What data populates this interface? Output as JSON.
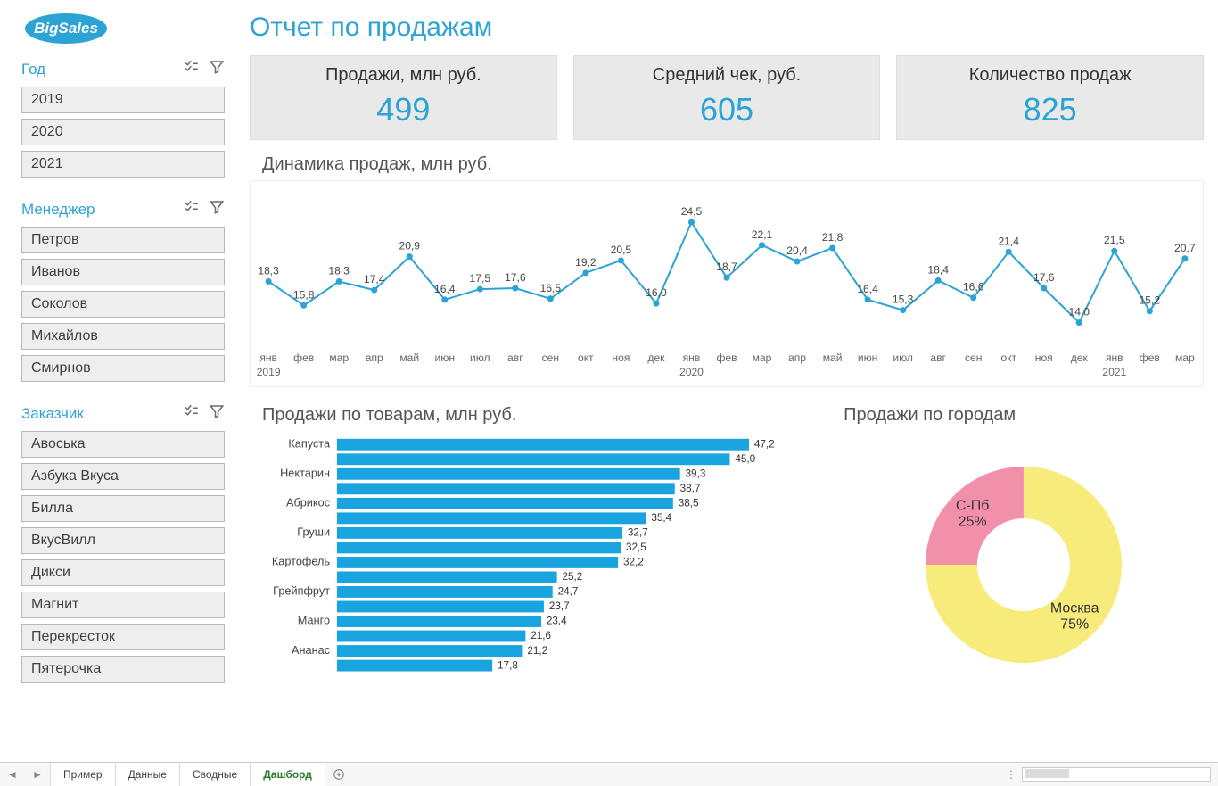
{
  "brand": "BigSales",
  "page_title": "Отчет по продажам",
  "slicers": {
    "year": {
      "title": "Год",
      "items": [
        "2019",
        "2020",
        "2021"
      ]
    },
    "manager": {
      "title": "Менеджер",
      "items": [
        "Петров",
        "Иванов",
        "Соколов",
        "Михайлов",
        "Смирнов"
      ]
    },
    "customer": {
      "title": "Заказчик",
      "items": [
        "Авоська",
        "Азбука Вкуса",
        "Билла",
        "ВкусВилл",
        "Дикси",
        "Магнит",
        "Перекресток",
        "Пятерочка"
      ]
    }
  },
  "cards": [
    {
      "label": "Продажи, млн руб.",
      "value": "499"
    },
    {
      "label": "Средний чек, руб.",
      "value": "605"
    },
    {
      "label": "Количество продаж",
      "value": "825"
    }
  ],
  "tabs": {
    "items": [
      "Пример",
      "Данные",
      "Сводные",
      "Дашборд"
    ],
    "active": "Дашборд"
  },
  "chart_data": [
    {
      "id": "trend",
      "type": "line",
      "title": "Динамика продаж, млн руб.",
      "x": [
        "янв",
        "фев",
        "мар",
        "апр",
        "май",
        "июн",
        "июл",
        "авг",
        "сен",
        "окт",
        "ноя",
        "дек",
        "янв",
        "фев",
        "мар",
        "апр",
        "май",
        "июн",
        "июл",
        "авг",
        "сен",
        "окт",
        "ноя",
        "дек",
        "янв",
        "фев",
        "мар"
      ],
      "year_group_labels": [
        {
          "label": "2019",
          "start_index": 0
        },
        {
          "label": "2020",
          "start_index": 12
        },
        {
          "label": "2021",
          "start_index": 24
        }
      ],
      "values": [
        18.3,
        15.8,
        18.3,
        17.4,
        20.9,
        16.4,
        17.5,
        17.6,
        16.5,
        19.2,
        20.5,
        16.0,
        24.5,
        18.7,
        22.1,
        20.4,
        21.8,
        16.4,
        15.3,
        18.4,
        16.6,
        21.4,
        17.6,
        14.0,
        21.5,
        15.2,
        20.7
      ],
      "ylim": [
        12,
        26
      ]
    },
    {
      "id": "products",
      "type": "bar",
      "orientation": "horizontal",
      "title": "Продажи по товарам, млн руб.",
      "categories": [
        "Капуста",
        "",
        "Нектарин",
        "",
        "Абрикос",
        "",
        "Груши",
        "",
        "Картофель",
        "",
        "Грейпфрут",
        "",
        "Манго",
        "",
        "Ананас",
        ""
      ],
      "values": [
        47.2,
        45.0,
        39.3,
        38.7,
        38.5,
        35.4,
        32.7,
        32.5,
        32.2,
        25.2,
        24.7,
        23.7,
        23.4,
        21.6,
        21.2,
        17.8
      ],
      "xlim": [
        0,
        50
      ]
    },
    {
      "id": "cities",
      "type": "pie",
      "title": "Продажи по городам",
      "series": [
        {
          "name": "Москва",
          "value": 75,
          "display": "Москва\n75%",
          "color": "#F6EB7B"
        },
        {
          "name": "С-Пб",
          "value": 25,
          "display": "С-Пб\n25%",
          "color": "#F28FA9"
        }
      ]
    }
  ],
  "colors": {
    "accent": "#2BA3D4",
    "bar": "#19A4E0"
  }
}
